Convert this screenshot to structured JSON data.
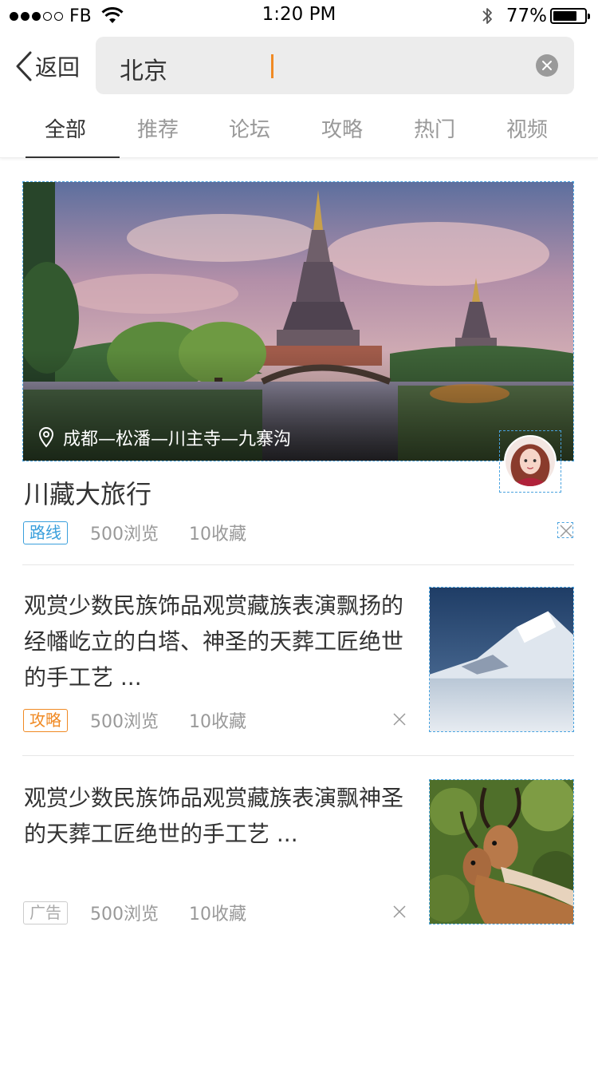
{
  "status_bar": {
    "carrier": "FB",
    "time": "1:20 PM",
    "battery_pct": "77%",
    "battery_level": 0.77,
    "signal_bars_filled": 3,
    "signal_bars_total": 5
  },
  "header": {
    "back_label": "返回",
    "search_value": "北京",
    "icons": [
      "chevron-left-icon",
      "clear-icon"
    ]
  },
  "tabs": [
    {
      "label": "全部",
      "active": true
    },
    {
      "label": "推荐",
      "active": false
    },
    {
      "label": "论坛",
      "active": false
    },
    {
      "label": "攻略",
      "active": false
    },
    {
      "label": "热门",
      "active": false
    },
    {
      "label": "视频",
      "active": false
    }
  ],
  "feed": [
    {
      "type": "route",
      "location": "成都—松潘—川主寺—九寨沟",
      "title": "川藏大旅行",
      "tag": "路线",
      "views": "500浏览",
      "favorites": "10收藏"
    },
    {
      "type": "guide",
      "text": "观赏少数民族饰品观赏藏族表演飘扬的经幡屹立的白塔、神圣的天葬工匠绝世的手工艺 ...",
      "tag": "攻略",
      "views": "500浏览",
      "favorites": "10收藏"
    },
    {
      "type": "ad",
      "text": "观赏少数民族饰品观赏藏族表演飘神圣的天葬工匠绝世的手工艺 ...",
      "tag": "广告",
      "views": "500浏览",
      "favorites": "10收藏"
    }
  ],
  "colors": {
    "accent_orange": "#f08a24",
    "accent_blue": "#3a9fdc",
    "tag_gray": "#cccccc"
  }
}
